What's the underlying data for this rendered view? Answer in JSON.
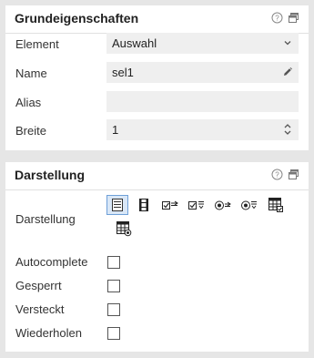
{
  "basic": {
    "title": "Grundeigenschaften",
    "fields": {
      "element": {
        "label": "Element",
        "value": "Auswahl"
      },
      "name": {
        "label": "Name",
        "value": "sel1"
      },
      "alias": {
        "label": "Alias",
        "value": ""
      },
      "breite": {
        "label": "Breite",
        "value": "1"
      }
    }
  },
  "display": {
    "title": "Darstellung",
    "darstellung_label": "Darstellung",
    "style_options": [
      "listbox-icon",
      "filmstrip-icon",
      "checkbox-list-horizontal-icon",
      "checkbox-list-vertical-icon",
      "radio-list-horizontal-icon",
      "radio-list-vertical-icon",
      "table-checkbox-icon",
      "table-radio-icon"
    ],
    "selected_style": "listbox-icon",
    "checkboxes": [
      {
        "label": "Autocomplete",
        "checked": false
      },
      {
        "label": "Gesperrt",
        "checked": false
      },
      {
        "label": "Versteckt",
        "checked": false
      },
      {
        "label": "Wiederholen",
        "checked": false
      }
    ]
  },
  "colors": {
    "background": "#e6e6e6",
    "field_bg": "#efefef",
    "selected_accent": "#6fa0d8"
  },
  "header_icons": [
    "help-icon",
    "window-icon"
  ]
}
